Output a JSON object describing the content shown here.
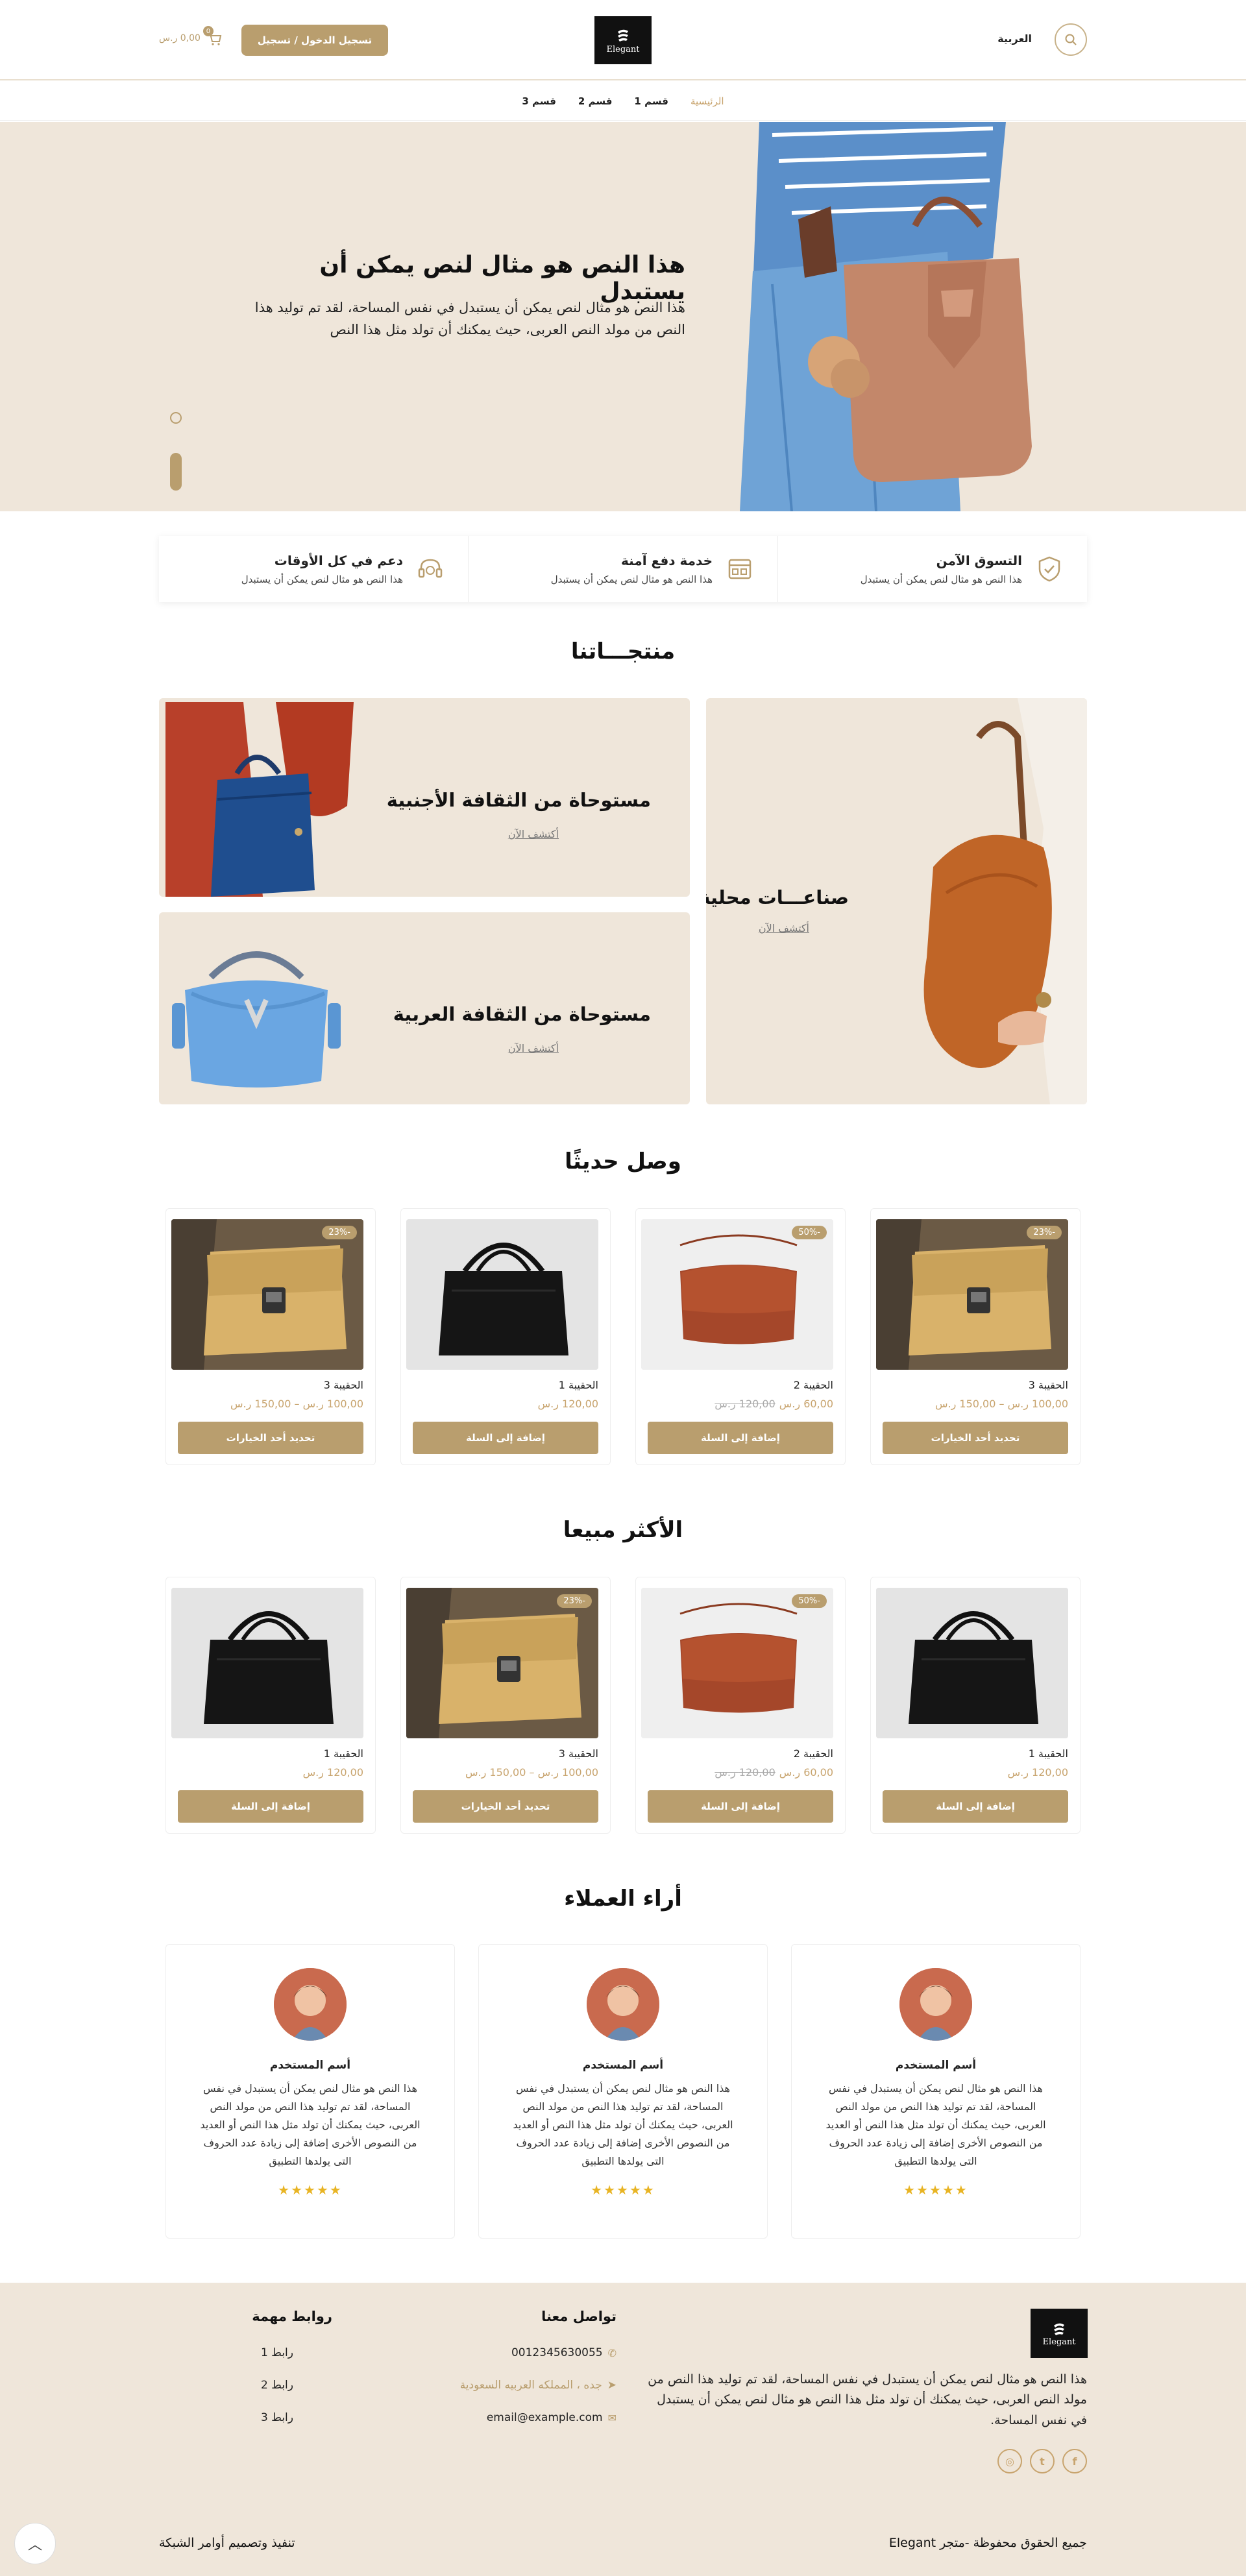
{
  "header": {
    "language": "العربية",
    "logo_text": "Elegant",
    "login_label": "تسجيل الدخول / تسجيل",
    "cart_total": "0,00 ر.س",
    "cart_count": "0"
  },
  "nav": {
    "items": [
      {
        "label": "الرئيسية",
        "active": true
      },
      {
        "label": "قسم 1"
      },
      {
        "label": "قسم 2"
      },
      {
        "label": "قسم 3"
      }
    ]
  },
  "hero": {
    "title": "هذا النص هو مثال لنص يمكن أن يستبدل",
    "text": "هذا النص هو مثال لنص يمكن أن يستبدل في نفس المساحة، لقد تم توليد هذا النص من مولد النص العربى، حيث يمكنك أن تولد مثل هذا النص"
  },
  "features": [
    {
      "title": "التسوق الآمن",
      "text": "هذا النص هو مثال لنص يمكن أن يستبدل",
      "icon": "shield-check-icon"
    },
    {
      "title": "خدمة دفع آمنة",
      "text": "هذا النص هو مثال لنص يمكن أن يستبدل",
      "icon": "payment-icon"
    },
    {
      "title": "دعم في كل الأوقات",
      "text": "هذا النص هو مثال لنص يمكن أن يستبدل",
      "icon": "support-icon"
    }
  ],
  "products_section": {
    "title": "منتجـــاتنا",
    "categories": [
      {
        "title": "صناعـــات محلية",
        "link": "أكتشف الآن"
      },
      {
        "title": "مستوحاة من الثقافة الأجنبية",
        "link": "أكتشف الآن"
      },
      {
        "title": "مستوحاة من الثقافة العربية",
        "link": "أكتشف الآن"
      }
    ]
  },
  "new_arrivals": {
    "title": "وصل حديثًا",
    "items": [
      {
        "name": "الحقيبة 3",
        "price": "100,00 ر.س – 150,00 ر.س",
        "old_price": "",
        "badge": "-23%",
        "button": "تحديد أحد الخيارات",
        "image": "tan-bag"
      },
      {
        "name": "الحقيبة 2",
        "price": "60,00 ر.س",
        "old_price": "120,00 ر.س",
        "badge": "-50%",
        "button": "إضافة إلى السلة",
        "image": "brown-bag"
      },
      {
        "name": "الحقيبة 1",
        "price": "120,00 ر.س",
        "old_price": "",
        "badge": "",
        "button": "إضافة إلى السلة",
        "image": "black-bag"
      },
      {
        "name": "الحقيبة 3",
        "price": "100,00 ر.س – 150,00 ر.س",
        "old_price": "",
        "badge": "-23%",
        "button": "تحديد أحد الخيارات",
        "image": "tan-bag"
      }
    ]
  },
  "best_sellers": {
    "title": "الأكثر مبيعا",
    "items": [
      {
        "name": "الحقيبة 1",
        "price": "120,00 ر.س",
        "old_price": "",
        "badge": "",
        "button": "إضافة إلى السلة",
        "image": "black-bag"
      },
      {
        "name": "الحقيبة 2",
        "price": "60,00 ر.س",
        "old_price": "120,00 ر.س",
        "badge": "-50%",
        "button": "إضافة إلى السلة",
        "image": "brown-bag"
      },
      {
        "name": "الحقيبة 3",
        "price": "100,00 ر.س – 150,00 ر.س",
        "old_price": "",
        "badge": "-23%",
        "button": "تحديد أحد الخيارات",
        "image": "tan-bag"
      },
      {
        "name": "الحقيبة 1",
        "price": "120,00 ر.س",
        "old_price": "",
        "badge": "",
        "button": "إضافة إلى السلة",
        "image": "black-bag"
      }
    ]
  },
  "testimonials": {
    "title": "أراء العملاء",
    "items": [
      {
        "name": "أسم المستخدم",
        "text": "هذا النص هو مثال لنص يمكن أن يستبدل في نفس المساحة، لقد تم توليد هذا النص من مولد النص العربى، حيث يمكنك أن تولد مثل هذا النص أو العديد من النصوص الأخرى إضافة إلى زيادة عدد الحروف التى يولدها التطبيق",
        "stars": "★★★★★"
      },
      {
        "name": "أسم المستخدم",
        "text": "هذا النص هو مثال لنص يمكن أن يستبدل في نفس المساحة، لقد تم توليد هذا النص من مولد النص العربى، حيث يمكنك أن تولد مثل هذا النص أو العديد من النصوص الأخرى إضافة إلى زيادة عدد الحروف التى يولدها التطبيق",
        "stars": "★★★★★"
      },
      {
        "name": "أسم المستخدم",
        "text": "هذا النص هو مثال لنص يمكن أن يستبدل في نفس المساحة، لقد تم توليد هذا النص من مولد النص العربى، حيث يمكنك أن تولد مثل هذا النص أو العديد من النصوص الأخرى إضافة إلى زيادة عدد الحروف التى يولدها التطبيق",
        "stars": "★★★★★"
      }
    ]
  },
  "footer": {
    "logo_text": "Elegant",
    "about": "هذا النص هو مثال لنص يمكن أن يستبدل في نفس المساحة، لقد تم توليد هذا النص من مولد النص العربى، حيث يمكنك أن تولد مثل هذا النص هو مثال لنص يمكن أن يستبدل في نفس المساحة.",
    "contact_title": "تواصل معنا",
    "phone": "0012345630055",
    "address": "جده ، المملكه العربيه السعودية",
    "email": "email@example.com",
    "links_title": "روابط مهمة",
    "links": [
      "رابط 1",
      "رابط 2",
      "رابط 3"
    ],
    "copyright": "جميع الحقوق محفوظة -متجر Elegant",
    "developer": "تنفيذ وتصميم أوامر الشبكة",
    "social": [
      "facebook-icon",
      "twitter-icon",
      "instagram-icon"
    ]
  },
  "colors": {
    "accent": "#b99e6e",
    "beige_bg": "#efe6da",
    "gold_text": "#c8a46e"
  }
}
